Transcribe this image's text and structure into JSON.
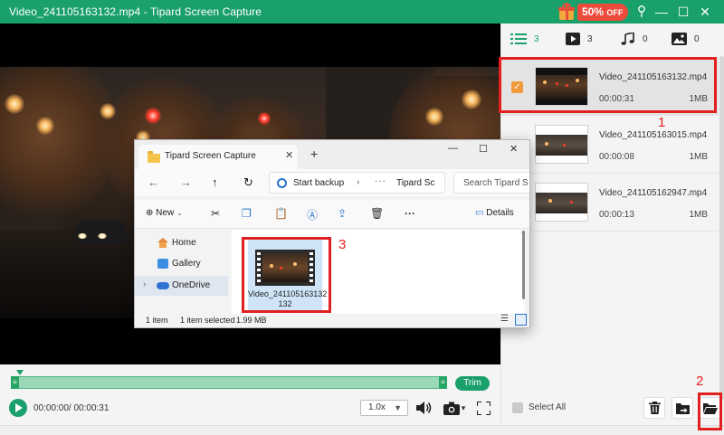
{
  "window": {
    "title": "Video_241105163132.mp4   -   Tipard Screen Capture",
    "promo_percent": "50%",
    "promo_off": "OFF",
    "minimize_glyph": "—",
    "maximize_glyph": "☐",
    "close_glyph": "✕",
    "help_glyph": "?"
  },
  "filter_tabs": [
    {
      "icon": "list-icon",
      "count": "3"
    },
    {
      "icon": "video-icon",
      "count": "3"
    },
    {
      "icon": "music-note-icon",
      "count": "0"
    },
    {
      "icon": "image-icon",
      "count": "0"
    }
  ],
  "files": [
    {
      "name": "Video_241105163132.mp4",
      "duration": "00:00:31",
      "size": "1MB",
      "selected": true
    },
    {
      "name": "Video_241105163015.mp4",
      "duration": "00:00:08",
      "size": "1MB",
      "selected": false
    },
    {
      "name": "Video_241105162947.mp4",
      "duration": "00:00:13",
      "size": "1MB",
      "selected": false
    }
  ],
  "annotations": {
    "one": "1",
    "two": "2",
    "three": "3"
  },
  "player": {
    "trim_label": "Trim",
    "time": "00:00:00/ 00:00:31",
    "speed": "1.0x"
  },
  "list_footer": {
    "select_all": "Select All"
  },
  "explorer": {
    "tab_title": "Tipard Screen Capture",
    "close_tab": "✕",
    "new_tab": "+",
    "address_backup": "Start backup",
    "address_sep": "›",
    "address_more": "···",
    "address_crumb": "Tipard Sc",
    "search_placeholder": "Search Tipard S",
    "new_label": "New",
    "details_label": "Details",
    "more_glyph": "···",
    "nav_items": [
      {
        "label": "Home"
      },
      {
        "label": "Gallery"
      },
      {
        "label": "OneDrive"
      }
    ],
    "file": {
      "caption": "Video_241105163132"
    },
    "status_count": "1 item",
    "status_selected": "1 item selected",
    "status_size": "1.99 MB"
  },
  "colors": {
    "brand_green": "#1aa06b",
    "annotation_red": "#e32020",
    "checkbox_orange": "#f09a3c",
    "promo_red": "#ec4b3b"
  }
}
